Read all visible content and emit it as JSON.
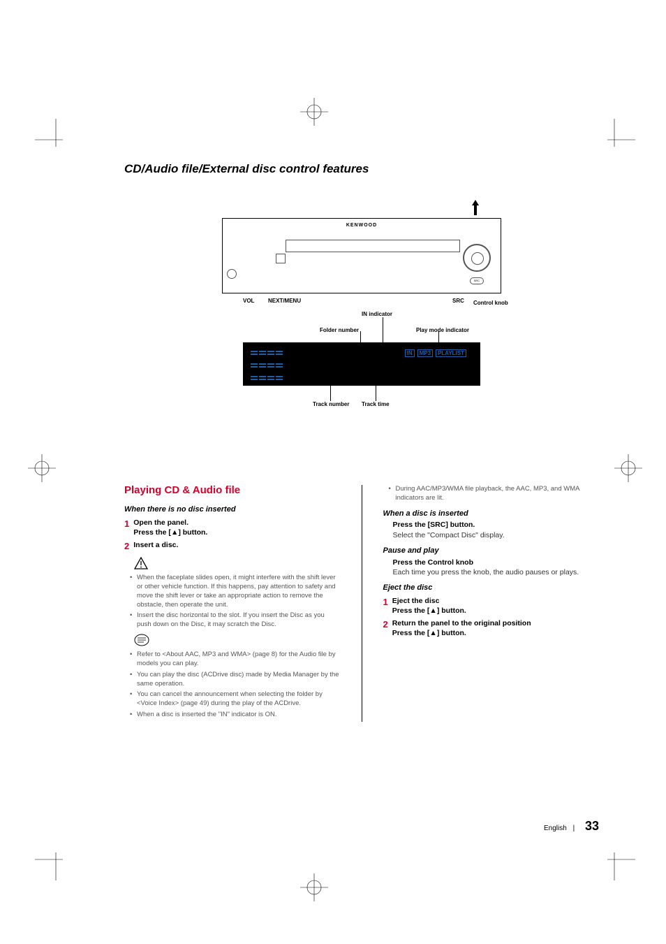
{
  "section_title": "CD/Audio file/External disc control features",
  "figure": {
    "brand": "KENWOOD",
    "labels": {
      "vol": "VOL",
      "next_menu": "NEXT/MENU",
      "src": "SRC",
      "control_knob": "Control knob",
      "in_indicator": "IN indicator",
      "folder_number": "Folder number",
      "play_mode_indicator": "Play mode indicator",
      "track_number": "Track number",
      "track_time": "Track time"
    },
    "display_tags": [
      "IN",
      "MP3",
      "PLAYLIST"
    ]
  },
  "left": {
    "heading": "Playing CD & Audio file",
    "sub1": "When there is no disc inserted",
    "step1_num": "1",
    "step1_a": "Open the panel.",
    "step1_b_pre": "Press the [",
    "step1_b_sym": "▲",
    "step1_b_post": "] button.",
    "step2_num": "2",
    "step2_a": "Insert a disc.",
    "warn_list": [
      "When the faceplate slides open, it might interfere with the shift lever or other vehicle function. If this happens, pay attention to safety and move the shift lever or take an appropriate action to remove the obstacle, then operate the unit.",
      "Insert the disc horizontal to the slot. If you insert the Disc as you push down on the Disc, it may scratch the Disc."
    ],
    "note_list": [
      "Refer to <About AAC, MP3 and WMA> (page 8) for the Audio file by models you can play.",
      "You can play the disc (ACDrive disc) made by Media Manager by the same operation.",
      "You can cancel the announcement when selecting the folder by <Voice Index> (page 49) during the play of the ACDrive.",
      "When a disc is inserted the \"IN\" indicator is ON."
    ]
  },
  "right": {
    "top_note": "During AAC/MP3/WMA file playback, the AAC, MP3, and WMA indicators are lit.",
    "sub1": "When a disc is inserted",
    "sub1_bold": "Press the [SRC] button.",
    "sub1_plain": "Select the \"Compact Disc\" display.",
    "sub2": "Pause and play",
    "sub2_bold": "Press the Control knob",
    "sub2_plain": "Each time you press the knob, the audio pauses or plays.",
    "sub3": "Eject the disc",
    "step1_num": "1",
    "step1_a": "Eject the disc",
    "step1_b_pre": "Press the [",
    "step1_b_sym": "▲",
    "step1_b_post": "] button.",
    "step2_num": "2",
    "step2_a": "Return the panel to the original position",
    "step2_b_pre": "Press the [",
    "step2_b_sym": "▲",
    "step2_b_post": "] button."
  },
  "footer": {
    "lang": "English",
    "sep": "|",
    "page": "33"
  }
}
